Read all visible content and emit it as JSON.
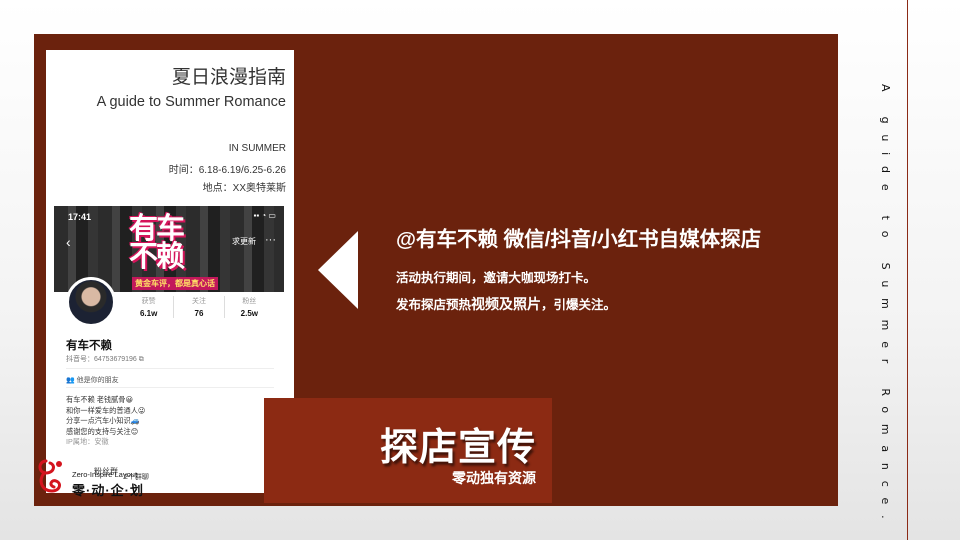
{
  "vertical_title": "A guide to Summer Romance.",
  "poster": {
    "title": "夏日浪漫指南",
    "subtitle": "A guide to Summer Romance",
    "season": "IN SUMMER",
    "time": "时间：6.18-6.19/6.25-6.26",
    "location": "地点：XX奥特莱斯"
  },
  "profile": {
    "status_time": "17:41",
    "status_icons": "▪▪ ◔ ▭",
    "back_icon": "‹",
    "logo_text_line1": "有车",
    "logo_text_line2": "不赖",
    "banner_caption": "黄金车评，都是真心话",
    "follow_label": "求更新",
    "more_icon": "···",
    "stats": [
      {
        "label": "获赞",
        "value": "6.1w"
      },
      {
        "label": "关注",
        "value": "76"
      },
      {
        "label": "粉丝",
        "value": "2.5w"
      }
    ],
    "name": "有车不赖",
    "account_id": "抖音号：64753679196 ⧉",
    "friends_label": "他是你的朋友",
    "bio": [
      "有车不赖 老钱腻骨😀",
      "和你一样爱车的普通人😜",
      "分享一点汽车小知识🚙",
      "感谢您的支持与关注😊"
    ],
    "ip": "IP属地：安徽",
    "overlay_a": "粉丝群",
    "overlay_b": "2个群聊"
  },
  "brand": {
    "en": "Zero-Inspire Layout",
    "cn": "零·动·企·划"
  },
  "main": {
    "heading": "@有车不赖 微信/抖音/小红书自媒体探店",
    "line1": "活动执行期间，邀请大咖现场打卡。",
    "line2_prefix": "发布探店预热",
    "line2_emphasis": "视频及照片",
    "line2_suffix": "，引爆关注。"
  },
  "badge": {
    "title": "探店宣传",
    "subtitle": "零动独有资源"
  },
  "colors": {
    "panel": "#6b220d",
    "badge": "#8c2a13",
    "accent_line": "#8b2a16"
  }
}
